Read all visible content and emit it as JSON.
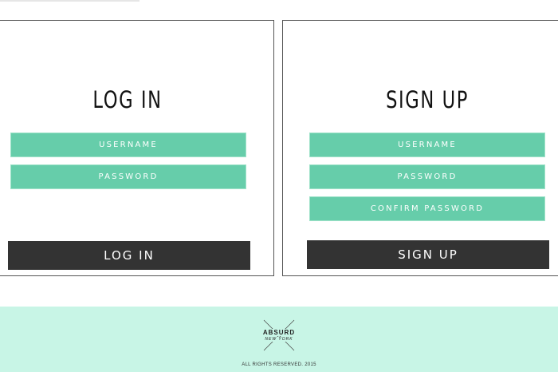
{
  "login": {
    "title": "LOG IN",
    "fields": {
      "username": "USERNAME",
      "password": "PASSWORD"
    },
    "button": "LOG IN"
  },
  "signup": {
    "title": "SIGN UP",
    "fields": {
      "username": "USERNAME",
      "password": "PASSWORD",
      "confirm_password": "CONFIRM PASSWORD"
    },
    "button": "SIGN UP"
  },
  "footer": {
    "logo_main": "ABSURD",
    "logo_sub": "NEW YORK",
    "copyright": "ALL RIGHTS RESERVED. 2015"
  },
  "colors": {
    "field_bg": "#66cdaa",
    "button_bg": "#333333",
    "footer_bg": "#c8f5e6"
  }
}
